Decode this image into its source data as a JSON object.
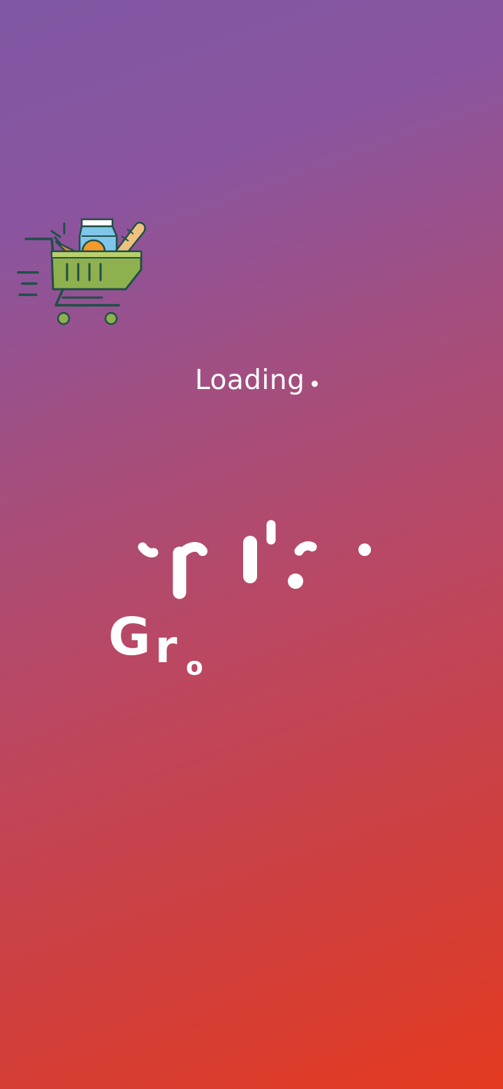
{
  "loading": {
    "label": "Loading"
  },
  "title_fragment": {
    "text_g": "G",
    "text_r": "r",
    "text_o": "o"
  },
  "colors": {
    "gradient_top": "#7f57a2",
    "gradient_bottom": "#e3391f",
    "text": "#ffffff",
    "cart_green": "#8fb04e",
    "cart_outline": "#1f4f47"
  },
  "icons": {
    "cart": "shopping-cart-icon"
  }
}
